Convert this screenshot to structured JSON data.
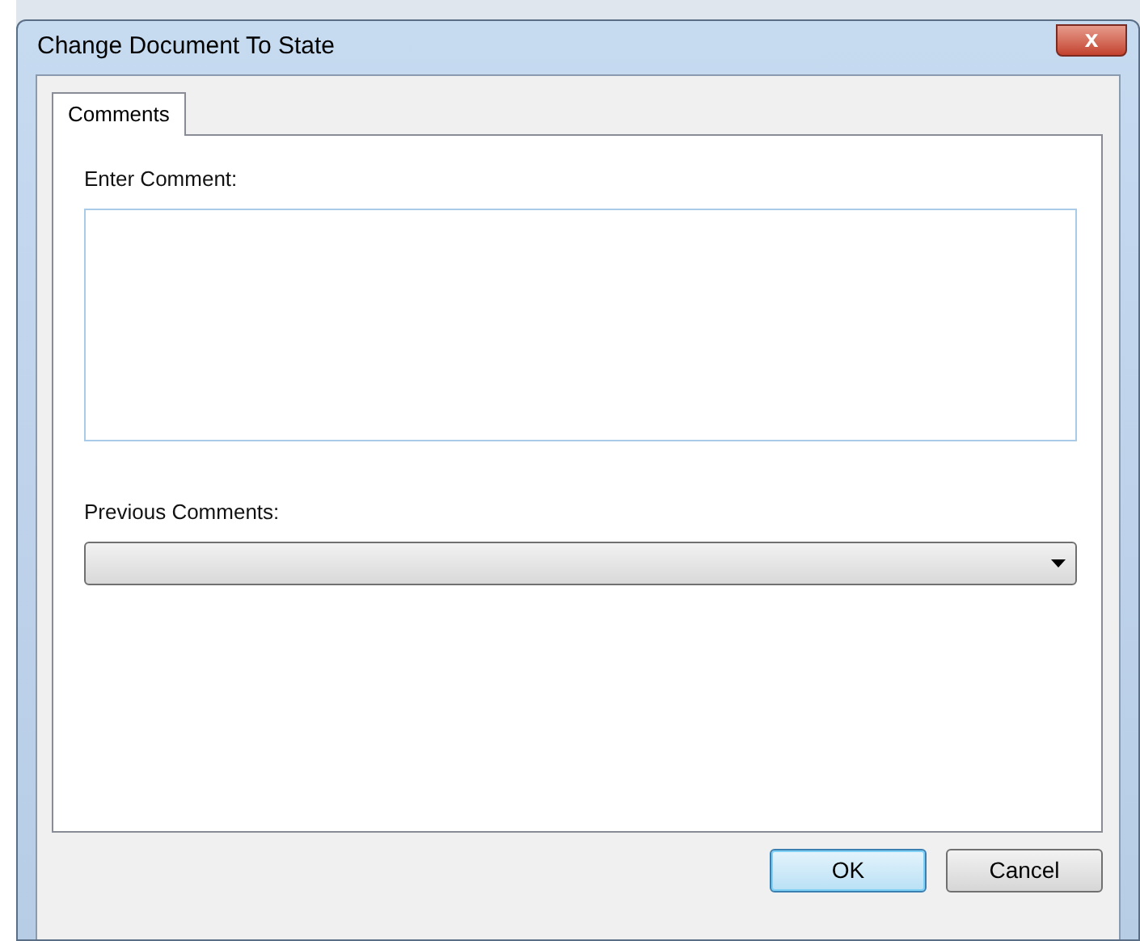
{
  "window": {
    "title": "Change Document To State",
    "close": "x"
  },
  "tabs": [
    {
      "label": "Comments",
      "selected": true
    }
  ],
  "comment": {
    "label": "Enter Comment:"
  },
  "previous_comments": {
    "label": "Previous Comments:"
  },
  "buttons": [
    {
      "label": "OK",
      "default": true
    },
    {
      "label": "Cancel",
      "default": false
    }
  ]
}
